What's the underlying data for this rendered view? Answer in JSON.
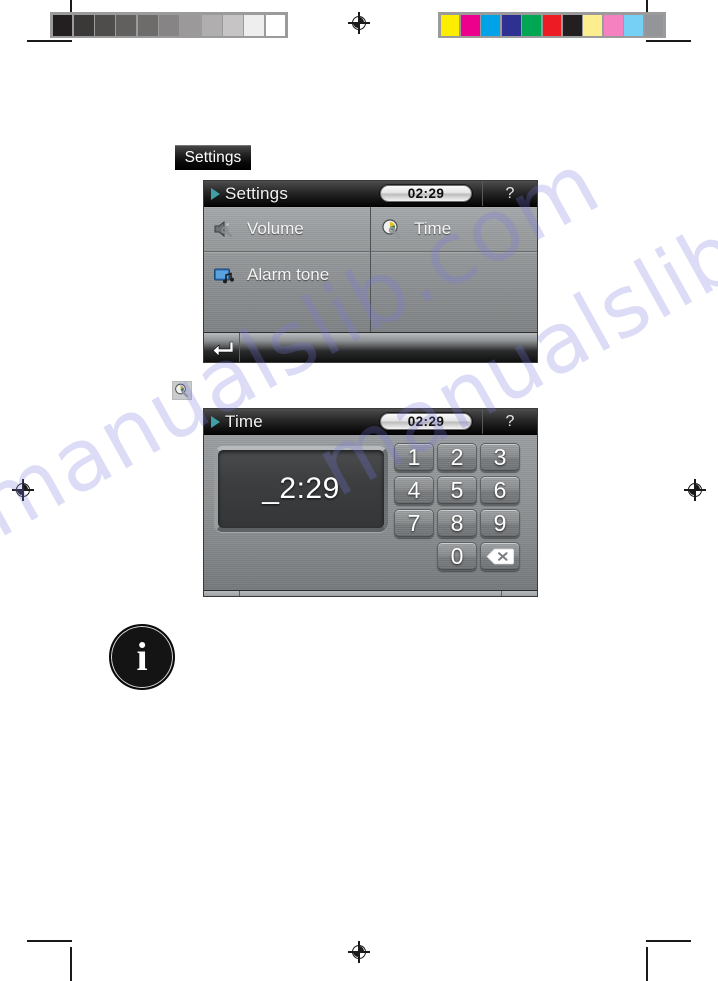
{
  "page": {
    "watermark_text": "manualslib.com",
    "watermark_text_2": "manualslib.com"
  },
  "calibration": {
    "grayscale_label": "grayscale-step-wedge",
    "grayscale_swatches": [
      "#231f20",
      "#3b3838",
      "#4f4c4c",
      "#625f5f",
      "#6e6b6b",
      "#868484",
      "#9b9999",
      "#b0aeae",
      "#c6c4c4",
      "#eeeeee",
      "#ffffff"
    ],
    "color_label": "color-control-bar",
    "color_swatches": [
      "#fded00",
      "#ec008c",
      "#00a2e8",
      "#2e3192",
      "#00a651",
      "#ed1c24",
      "#231f20",
      "#fcee8f",
      "#f681c0",
      "#76d0f5",
      "#939598"
    ]
  },
  "caption": {
    "label": "Settings"
  },
  "settings_screen": {
    "name": "settings-menu-screen",
    "titlebar": {
      "title": "Settings",
      "clock": "02:29",
      "help_label": "?",
      "marker_color": "#3f9fa8"
    },
    "items": [
      {
        "label": "Volume",
        "icon": "speaker-wrench-icon",
        "column": "left"
      },
      {
        "label": "Alarm tone",
        "icon": "alarm-tone-icon",
        "column": "left"
      },
      {
        "label": "Time",
        "icon": "clock-wrench-icon",
        "column": "right"
      }
    ],
    "bottombar": {
      "back_icon": "back-enter-arrow-icon"
    }
  },
  "step_marker": {
    "icon": "clock-wrench-icon"
  },
  "time_screen": {
    "name": "time-entry-screen",
    "titlebar": {
      "title": "Time",
      "clock": "02:29",
      "help_label": "?",
      "marker_color": "#3f9fa8"
    },
    "display_value": "_2:29",
    "keypad": [
      {
        "label": "1",
        "kind": "digit"
      },
      {
        "label": "2",
        "kind": "digit"
      },
      {
        "label": "3",
        "kind": "digit"
      },
      {
        "label": "4",
        "kind": "digit"
      },
      {
        "label": "5",
        "kind": "digit"
      },
      {
        "label": "6",
        "kind": "digit"
      },
      {
        "label": "7",
        "kind": "digit"
      },
      {
        "label": "8",
        "kind": "digit"
      },
      {
        "label": "9",
        "kind": "digit"
      },
      {
        "label": "",
        "kind": "empty"
      },
      {
        "label": "0",
        "kind": "digit"
      },
      {
        "label": "",
        "kind": "backspace"
      }
    ],
    "bottombar": {
      "back_icon": "back-enter-arrow-icon",
      "confirm_icon": "green-checkmark-icon",
      "confirm_color": "#3aa832"
    }
  },
  "info_badge": {
    "glyph": "i",
    "name": "information-badge"
  }
}
